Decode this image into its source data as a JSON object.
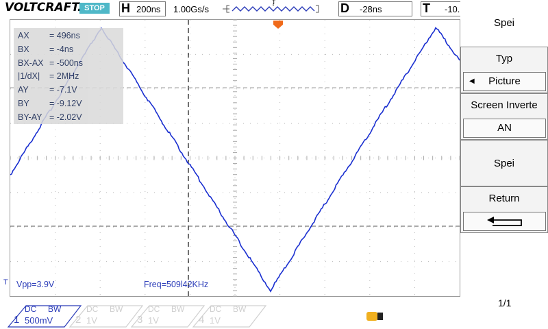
{
  "brand": "VOLTCRAFT.",
  "run_state": "STOP",
  "horizontal": {
    "letter": "H",
    "value": "200ns"
  },
  "sample_rate": "1.00Gs/s",
  "trigger_marker": "T",
  "delay": {
    "letter": "D",
    "value": "-28ns"
  },
  "trigger": {
    "letter": "T",
    "value": "-10."
  },
  "measurements": [
    {
      "label": "AX",
      "value": "= 496ns"
    },
    {
      "label": "BX",
      "value": "= -4ns"
    },
    {
      "label": "BX-AX",
      "value": "= -500ns"
    },
    {
      "label": "|1/dX|",
      "value": "= 2MHz"
    },
    {
      "label": "AY",
      "value": "= -7.1V"
    },
    {
      "label": "BY",
      "value": "= -9.12V"
    },
    {
      "label": "BY-AY",
      "value": "= -2.02V"
    }
  ],
  "vpp": "Vpp=3.9V",
  "freq": "Freq=509l42KHz",
  "channel_marker": "T",
  "side_menu": {
    "section1": "Spei",
    "section2_title": "Typ",
    "section2_value": "Picture",
    "section3_title": "Screen Inverte",
    "section3_value": "AN",
    "section4": "Spei",
    "section5_title": "Return"
  },
  "page_indicator": "1/1",
  "channels": [
    {
      "num": "1",
      "coupling": "DC",
      "bw": "BW",
      "volts": "500mV",
      "active": true
    },
    {
      "num": "2",
      "coupling": "DC",
      "bw": "BW",
      "volts": "1V",
      "active": false
    },
    {
      "num": "3",
      "coupling": "DC",
      "bw": "BW",
      "volts": "1V",
      "active": false
    },
    {
      "num": "4",
      "coupling": "DC",
      "bw": "BW",
      "volts": "1V",
      "active": false
    }
  ],
  "colors": {
    "trace": "#1a2fd0",
    "stop": "#4fb8c8",
    "trigger_marker": "#f06a1a",
    "measure_text": "#0b1d4a"
  }
}
